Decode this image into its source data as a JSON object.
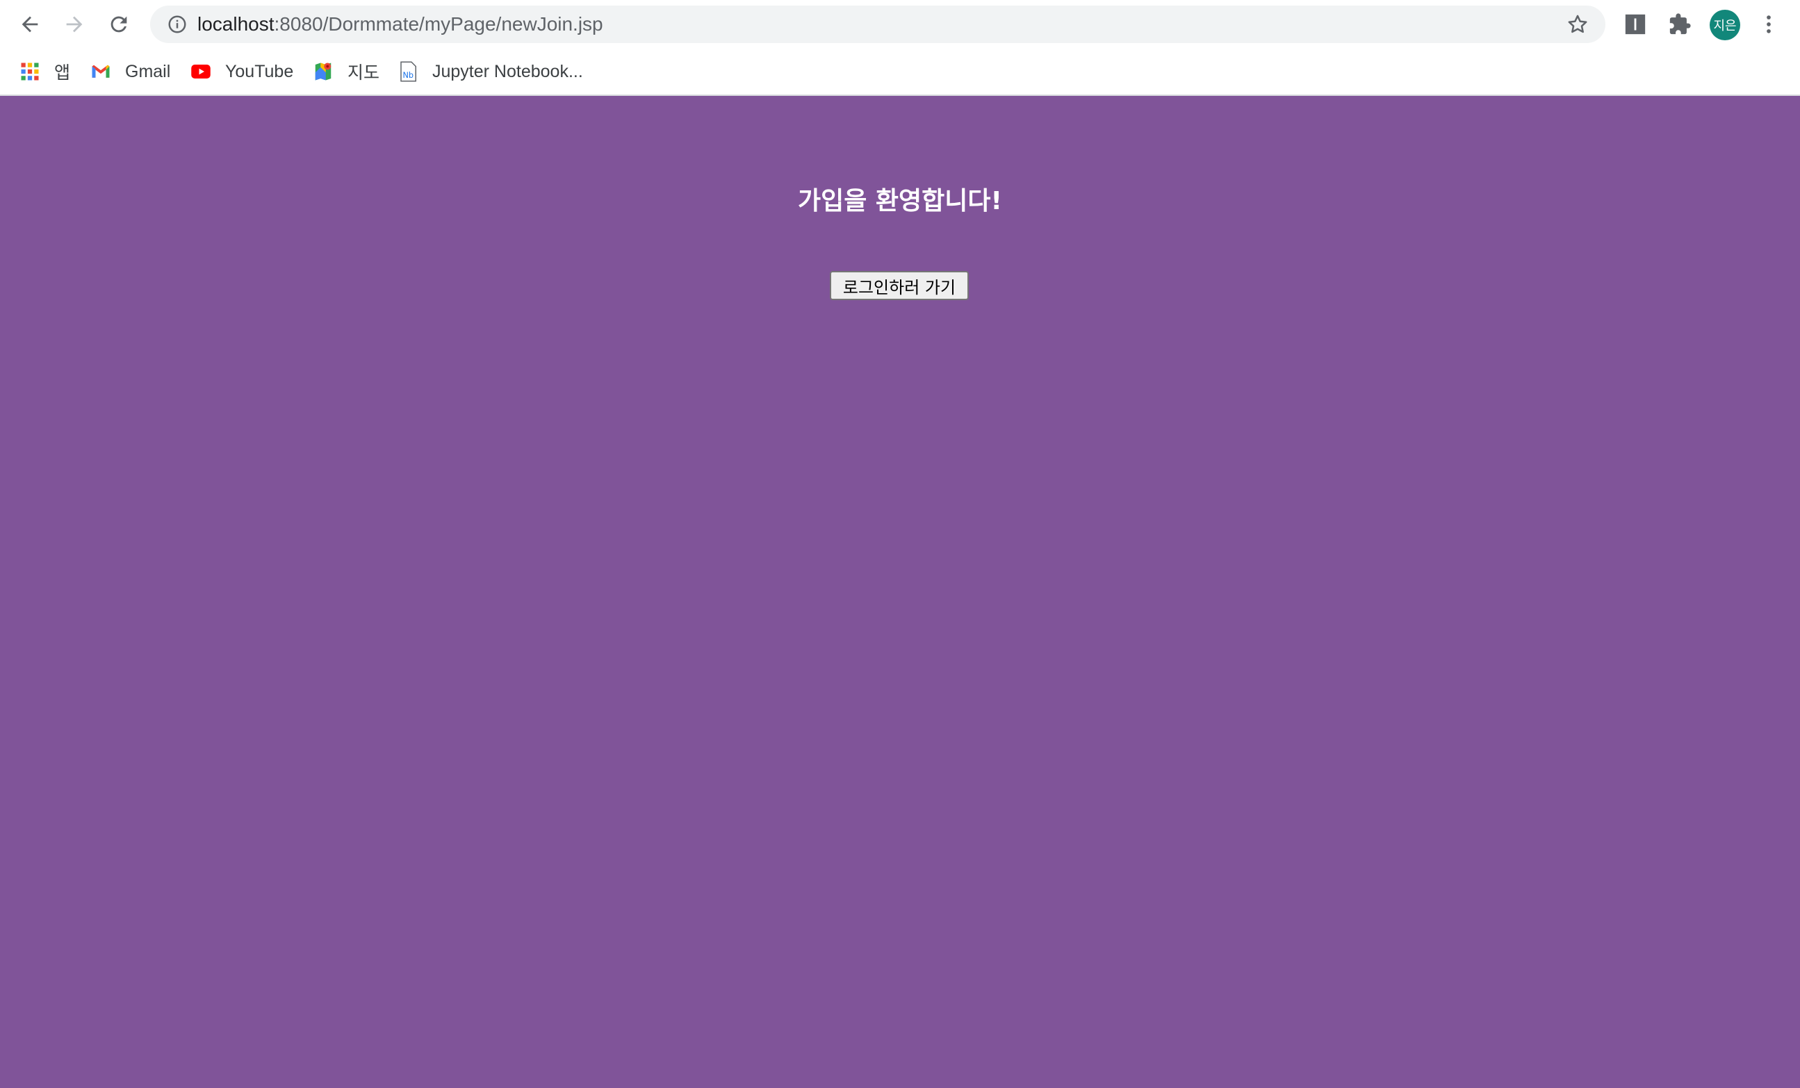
{
  "browser": {
    "url_host": "localhost",
    "url_path": ":8080/Dormmate/myPage/newJoin.jsp",
    "profile_initials": "지은"
  },
  "bookmarks": [
    {
      "label": "앱",
      "icon": "apps-grid-icon"
    },
    {
      "label": "Gmail",
      "icon": "gmail-icon"
    },
    {
      "label": "YouTube",
      "icon": "youtube-icon"
    },
    {
      "label": "지도",
      "icon": "maps-icon"
    },
    {
      "label": "Jupyter Notebook...",
      "icon": "jupyter-icon"
    }
  ],
  "page": {
    "heading": "가입을 환영합니다!",
    "login_button": "로그인하러 가기",
    "background_color": "#805499"
  }
}
